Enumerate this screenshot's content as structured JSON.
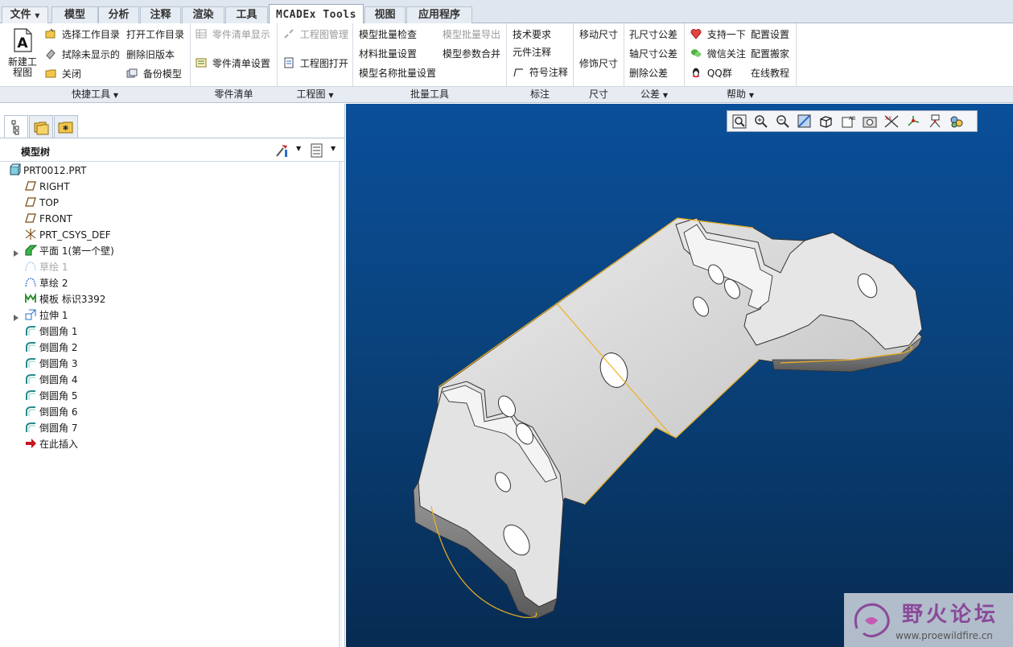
{
  "tabs": {
    "file": "文件",
    "model": "模型",
    "analysis": "分析",
    "annotate": "注释",
    "render": "渲染",
    "tools": "工具",
    "mcadex": "MCADEx Tools",
    "view": "视图",
    "apps": "应用程序"
  },
  "ribbon": {
    "quick": {
      "new_drawing_line1": "新建工",
      "new_drawing_line2": "程图",
      "select_dir": "选择工作目录",
      "open_dir": "打开工作目录",
      "erase_undisplayed": "拭除未显示的",
      "delete_old": "删除旧版本",
      "close": "关闭",
      "backup": "备份模型"
    },
    "bom": {
      "display": "零件清单显示",
      "settings": "零件清单设置"
    },
    "drawing": {
      "manage": "工程图管理",
      "open": "工程图打开"
    },
    "batch": {
      "check": "模型批量检查",
      "export": "模型批量导出",
      "material": "材料批量设置",
      "merge": "模型参数合并",
      "name": "模型名称批量设置"
    },
    "note": {
      "tech": "技术要求",
      "element": "元件注释",
      "symbol": "符号注释"
    },
    "dim": {
      "move": "移动尺寸",
      "cosmetic": "修饰尺寸"
    },
    "tol": {
      "hole": "孔尺寸公差",
      "shaft": "轴尺寸公差",
      "delete": "删除公差"
    },
    "help": {
      "support": "支持一下",
      "config": "配置设置",
      "wechat": "微信关注",
      "move_config": "配置搬家",
      "qq": "QQ群",
      "tutorial": "在线教程"
    },
    "groups": {
      "quick": "快捷工具",
      "bom": "零件清单",
      "drawing": "工程图",
      "batch": "批量工具",
      "note": "标注",
      "dim": "尺寸",
      "tol": "公差",
      "help": "帮助"
    }
  },
  "tree": {
    "title": "模型树",
    "items": [
      {
        "label": "PRT0012.PRT",
        "icon": "part-icon"
      },
      {
        "label": "RIGHT",
        "icon": "datum-plane-icon"
      },
      {
        "label": "TOP",
        "icon": "datum-plane-icon"
      },
      {
        "label": "FRONT",
        "icon": "datum-plane-icon"
      },
      {
        "label": "PRT_CSYS_DEF",
        "icon": "csys-icon"
      },
      {
        "label": "平面 1(第一个壁)",
        "icon": "sheetmetal-wall-icon"
      },
      {
        "label": "草绘 1",
        "icon": "sketch-icon",
        "dim": true
      },
      {
        "label": "草绘 2",
        "icon": "sketch-icon"
      },
      {
        "label": "模板 标识3392",
        "icon": "form-icon"
      },
      {
        "label": "拉伸 1",
        "icon": "extrude-icon"
      },
      {
        "label": "倒圆角 1",
        "icon": "round-icon"
      },
      {
        "label": "倒圆角 2",
        "icon": "round-icon"
      },
      {
        "label": "倒圆角 3",
        "icon": "round-icon"
      },
      {
        "label": "倒圆角 4",
        "icon": "round-icon"
      },
      {
        "label": "倒圆角 5",
        "icon": "round-icon"
      },
      {
        "label": "倒圆角 6",
        "icon": "round-icon"
      },
      {
        "label": "倒圆角 7",
        "icon": "round-icon"
      },
      {
        "label": "在此插入",
        "icon": "insert-here-icon"
      }
    ]
  },
  "watermark": {
    "title": "野火论坛",
    "url": "www.proewildfire.cn"
  },
  "colors": {
    "viewport_top": "#0a4f9a",
    "viewport_bottom": "#072b52",
    "edge_highlight": "#f0b020"
  }
}
